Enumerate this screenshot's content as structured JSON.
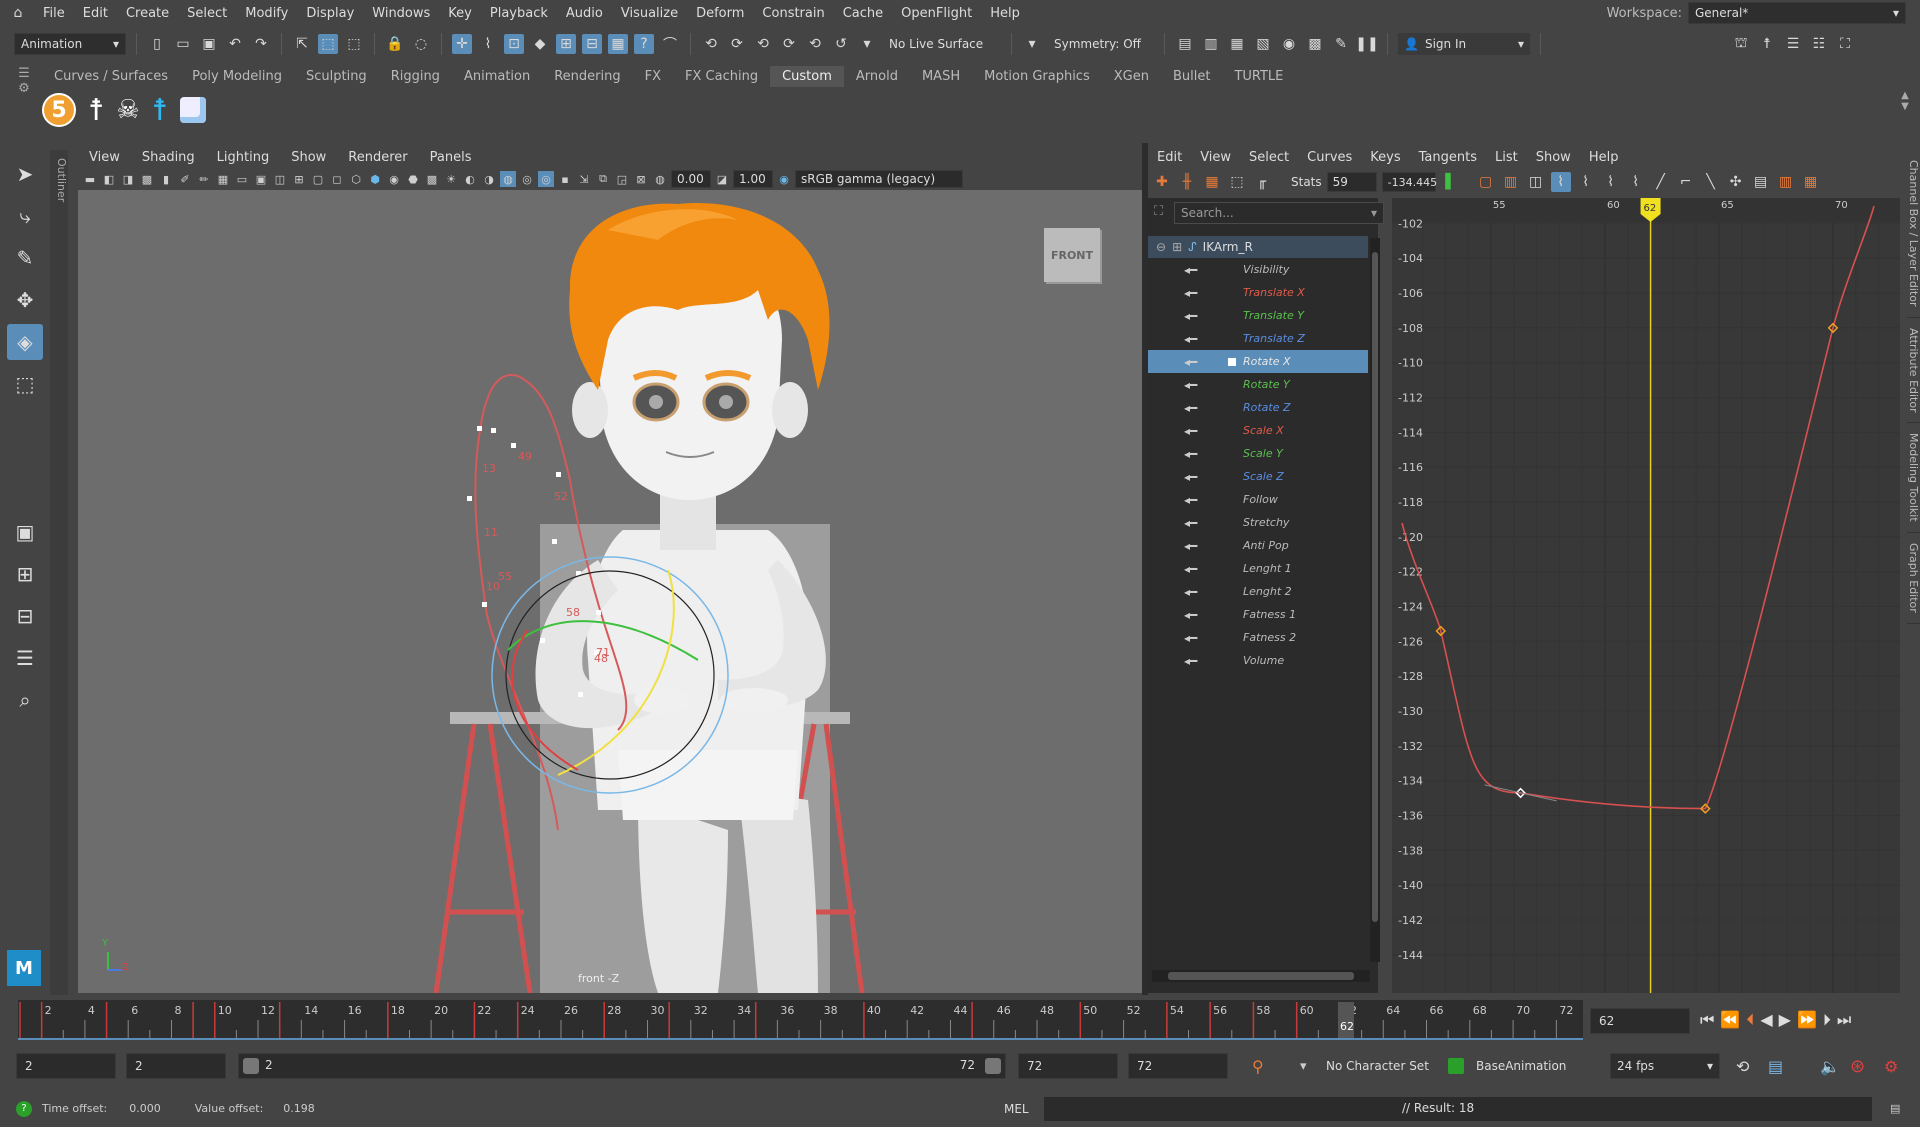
{
  "menubar": {
    "items": [
      "File",
      "Edit",
      "Create",
      "Select",
      "Modify",
      "Display",
      "Windows",
      "Key",
      "Playback",
      "Audio",
      "Visualize",
      "Deform",
      "Constrain",
      "Cache",
      "OpenFlight",
      "Help"
    ],
    "workspace_label": "Workspace:",
    "workspace_value": "General*"
  },
  "toolbar": {
    "mode": "Animation",
    "live_surface": "No Live Surface",
    "symmetry": "Symmetry: Off",
    "sign_in": "Sign In"
  },
  "shelf": {
    "tabs": [
      "Curves / Surfaces",
      "Poly Modeling",
      "Sculpting",
      "Rigging",
      "Animation",
      "Rendering",
      "FX",
      "FX Caching",
      "Custom",
      "Arnold",
      "MASH",
      "Motion Graphics",
      "XGen",
      "Bullet",
      "TURTLE"
    ],
    "active": "Custom",
    "badge": "5"
  },
  "outliner_label": "Outliner",
  "viewport": {
    "menus": [
      "View",
      "Shading",
      "Lighting",
      "Show",
      "Renderer",
      "Panels"
    ],
    "val1": "0.00",
    "val2": "1.00",
    "colorspace": "sRGB gamma (legacy)",
    "cube_label": "FRONT",
    "camera_label": "front -Z",
    "axis_y": "Y",
    "axis_z": "Z",
    "path_labels": [
      "49",
      "52",
      "13",
      "11",
      "10",
      "55",
      "58",
      "71",
      "48"
    ]
  },
  "graph_editor": {
    "menus": [
      "Edit",
      "View",
      "Select",
      "Curves",
      "Keys",
      "Tangents",
      "List",
      "Show",
      "Help"
    ],
    "stats_label": "Stats",
    "stats_val1": "59",
    "stats_val2": "-134.445",
    "search_placeholder": "Search...",
    "node": "IKArm_R",
    "attrs": [
      {
        "n": "Visibility",
        "c": "#bbbbbb"
      },
      {
        "n": "Translate X",
        "c": "#e05a4a"
      },
      {
        "n": "Translate Y",
        "c": "#5bbf4f"
      },
      {
        "n": "Translate Z",
        "c": "#5a8de0"
      },
      {
        "n": "Rotate X",
        "c": "#e8e8e8"
      },
      {
        "n": "Rotate Y",
        "c": "#5bbf4f"
      },
      {
        "n": "Rotate Z",
        "c": "#5a8de0"
      },
      {
        "n": "Scale X",
        "c": "#e05a4a"
      },
      {
        "n": "Scale Y",
        "c": "#5bbf4f"
      },
      {
        "n": "Scale Z",
        "c": "#5a8de0"
      },
      {
        "n": "Follow",
        "c": "#bbbbbb"
      },
      {
        "n": "Stretchy",
        "c": "#bbbbbb"
      },
      {
        "n": "Anti Pop",
        "c": "#bbbbbb"
      },
      {
        "n": "Lenght 1",
        "c": "#bbbbbb"
      },
      {
        "n": "Lenght 2",
        "c": "#bbbbbb"
      },
      {
        "n": "Fatness 1",
        "c": "#bbbbbb"
      },
      {
        "n": "Fatness 2",
        "c": "#bbbbbb"
      },
      {
        "n": "Volume",
        "c": "#bbbbbb"
      }
    ],
    "selected_attr": "Rotate X",
    "xticks": [
      "55",
      "60",
      "65",
      "70"
    ],
    "current_frame": "62",
    "yticks": [
      "-102",
      "-104",
      "-106",
      "-108",
      "-110",
      "-112",
      "-114",
      "-116",
      "-118",
      "-120",
      "-122",
      "-124",
      "-126",
      "-128",
      "-130",
      "-132",
      "-134",
      "-136",
      "-138",
      "-140",
      "-142",
      "-144"
    ]
  },
  "right_strip": [
    "Channel Box / Layer Editor",
    "Attribute Editor",
    "Modeling Toolkit",
    "Graph Editor"
  ],
  "timeline": {
    "ticks": [
      "2",
      "4",
      "6",
      "8",
      "10",
      "12",
      "14",
      "16",
      "18",
      "20",
      "22",
      "24",
      "26",
      "28",
      "30",
      "32",
      "34",
      "36",
      "38",
      "40",
      "42",
      "44",
      "46",
      "48",
      "50",
      "52",
      "54",
      "56",
      "58",
      "60",
      "62",
      "64",
      "66",
      "68",
      "70",
      "72"
    ],
    "current": "62",
    "frame_field": "62"
  },
  "range": {
    "start_outer": "2",
    "start_inner": "2",
    "slider_start": "2",
    "slider_end": "72",
    "end_inner": "72",
    "end_outer": "72",
    "character_set": "No Character Set",
    "anim_layer": "BaseAnimation",
    "fps": "24 fps"
  },
  "status": {
    "time_offset_label": "Time offset:",
    "time_offset": "0.000",
    "value_offset_label": "Value offset:",
    "value_offset": "0.198",
    "mel": "MEL",
    "result": "// Result: 18"
  }
}
